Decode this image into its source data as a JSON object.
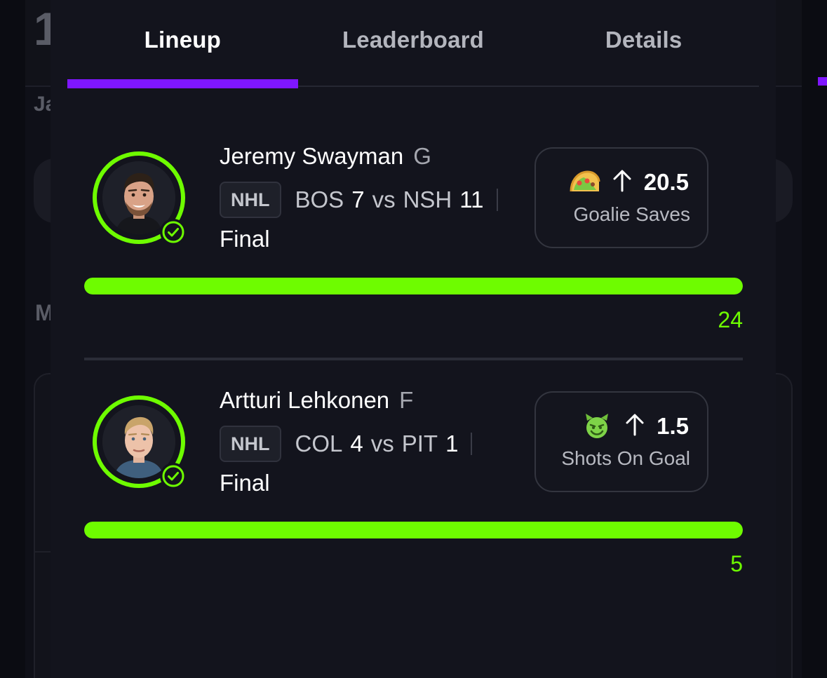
{
  "background": {
    "left_title_fragment": "1",
    "left_subtitle_fragment": "Ja",
    "left_section_fragment": "M"
  },
  "tabs": [
    {
      "label": "Lineup",
      "active": true
    },
    {
      "label": "Leaderboard",
      "active": false
    },
    {
      "label": "Details",
      "active": false
    }
  ],
  "accent_color": "#7f16ff",
  "success_color": "#6efc00",
  "picks": [
    {
      "player_name": "Jeremy Swayman",
      "position": "G",
      "league": "NHL",
      "away_team": "BOS",
      "away_score": "7",
      "vs": "vs",
      "home_team": "NSH",
      "home_score": "11",
      "status": "Final",
      "result_icon": "check-circle-icon",
      "prop_emoji": "taco-emoji",
      "direction_icon": "arrow-up-icon",
      "line": "20.5",
      "stat": "Goalie Saves",
      "progress_fraction": 1.0,
      "actual": "24"
    },
    {
      "player_name": "Artturi Lehkonen",
      "position": "F",
      "league": "NHL",
      "away_team": "COL",
      "away_score": "4",
      "vs": "vs",
      "home_team": "PIT",
      "home_score": "1",
      "status": "Final",
      "result_icon": "check-circle-icon",
      "prop_emoji": "smiling-devil-emoji",
      "direction_icon": "arrow-up-icon",
      "line": "1.5",
      "stat": "Shots On Goal",
      "progress_fraction": 1.0,
      "actual": "5"
    }
  ]
}
